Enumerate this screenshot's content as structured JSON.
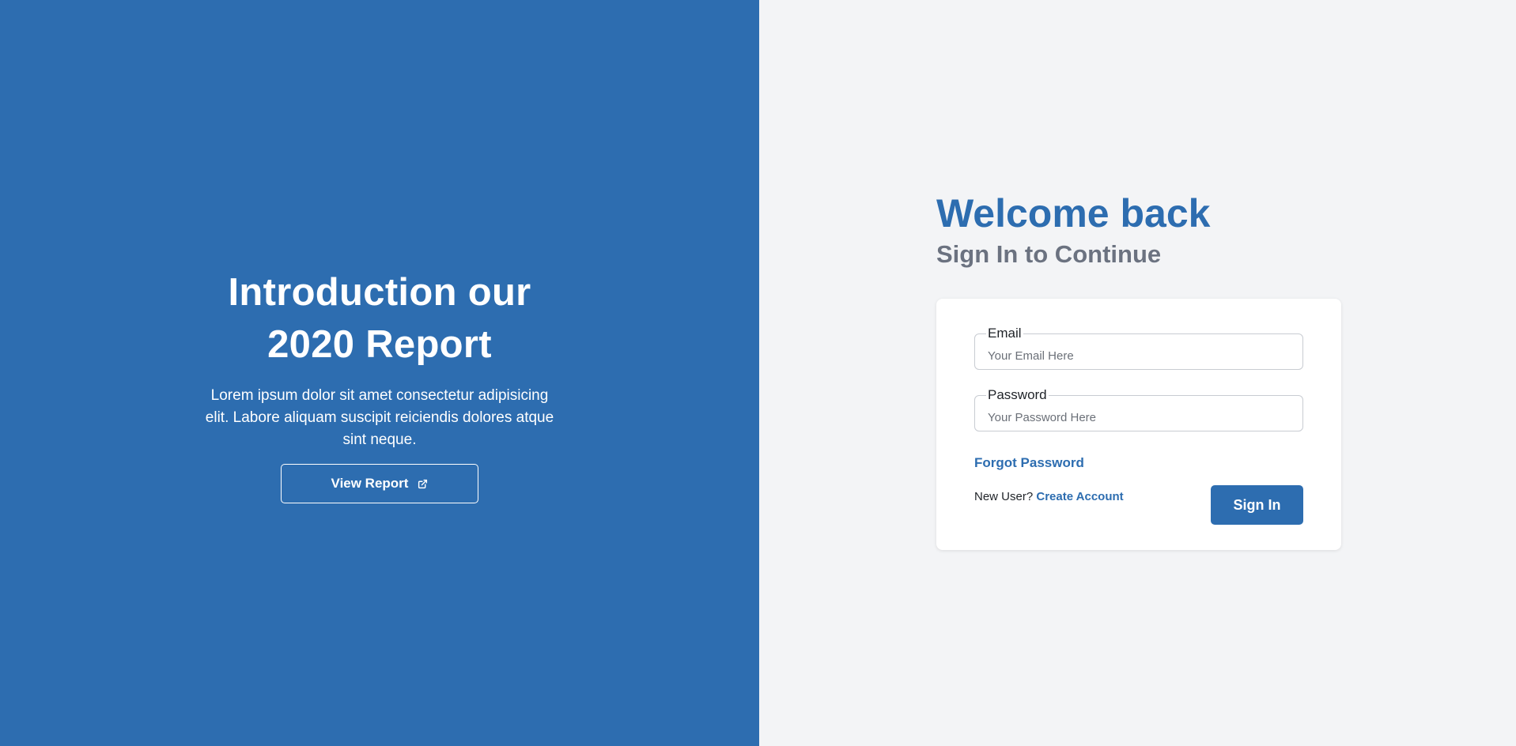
{
  "hero": {
    "title_line1": "Introduction our",
    "title_line2": "2020 Report",
    "description": "Lorem ipsum dolor sit amet consectetur adipisicing elit. Labore aliquam suscipit reiciendis dolores atque sint neque.",
    "button_label": "View Report",
    "button_icon": "external-link-icon"
  },
  "login": {
    "title": "Welcome back",
    "subtitle": "Sign In to Continue",
    "email": {
      "label": "Email",
      "placeholder": "Your Email Here",
      "value": ""
    },
    "password": {
      "label": "Password",
      "placeholder": "Your Password Here",
      "value": ""
    },
    "forgot_label": "Forgot Password",
    "new_user_text": "New User?",
    "create_account_label": "Create Account",
    "signin_label": "Sign In"
  },
  "colors": {
    "primary": "#2d6db0",
    "right_background": "#f3f4f6",
    "subtitle_gray": "#6b7280",
    "card_background": "#ffffff"
  }
}
